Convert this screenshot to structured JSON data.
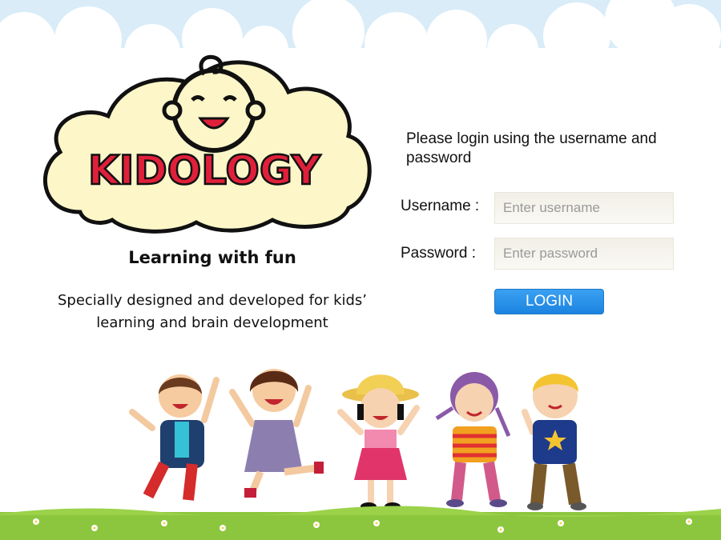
{
  "brand": {
    "logo_text": "KIDOLOGY",
    "tagline": "Learning with fun",
    "description_line1": "Specially designed and developed for kids’",
    "description_line2": "learning and brain development"
  },
  "login": {
    "intro": "Please login using the username and password",
    "username_label": "Username :",
    "username_placeholder": "Enter username",
    "password_label": "Password :",
    "password_placeholder": "Enter password",
    "button_label": "LOGIN"
  },
  "colors": {
    "sky": "#d9ecf8",
    "cloud": "#ffffff",
    "logo_cloud": "#fcf6c8",
    "logo_text": "#e0203a",
    "button": "#2190e8",
    "grass": "#8cc63f"
  },
  "icons": [
    "baby-face-icon",
    "kid-icon",
    "flower-icon"
  ]
}
